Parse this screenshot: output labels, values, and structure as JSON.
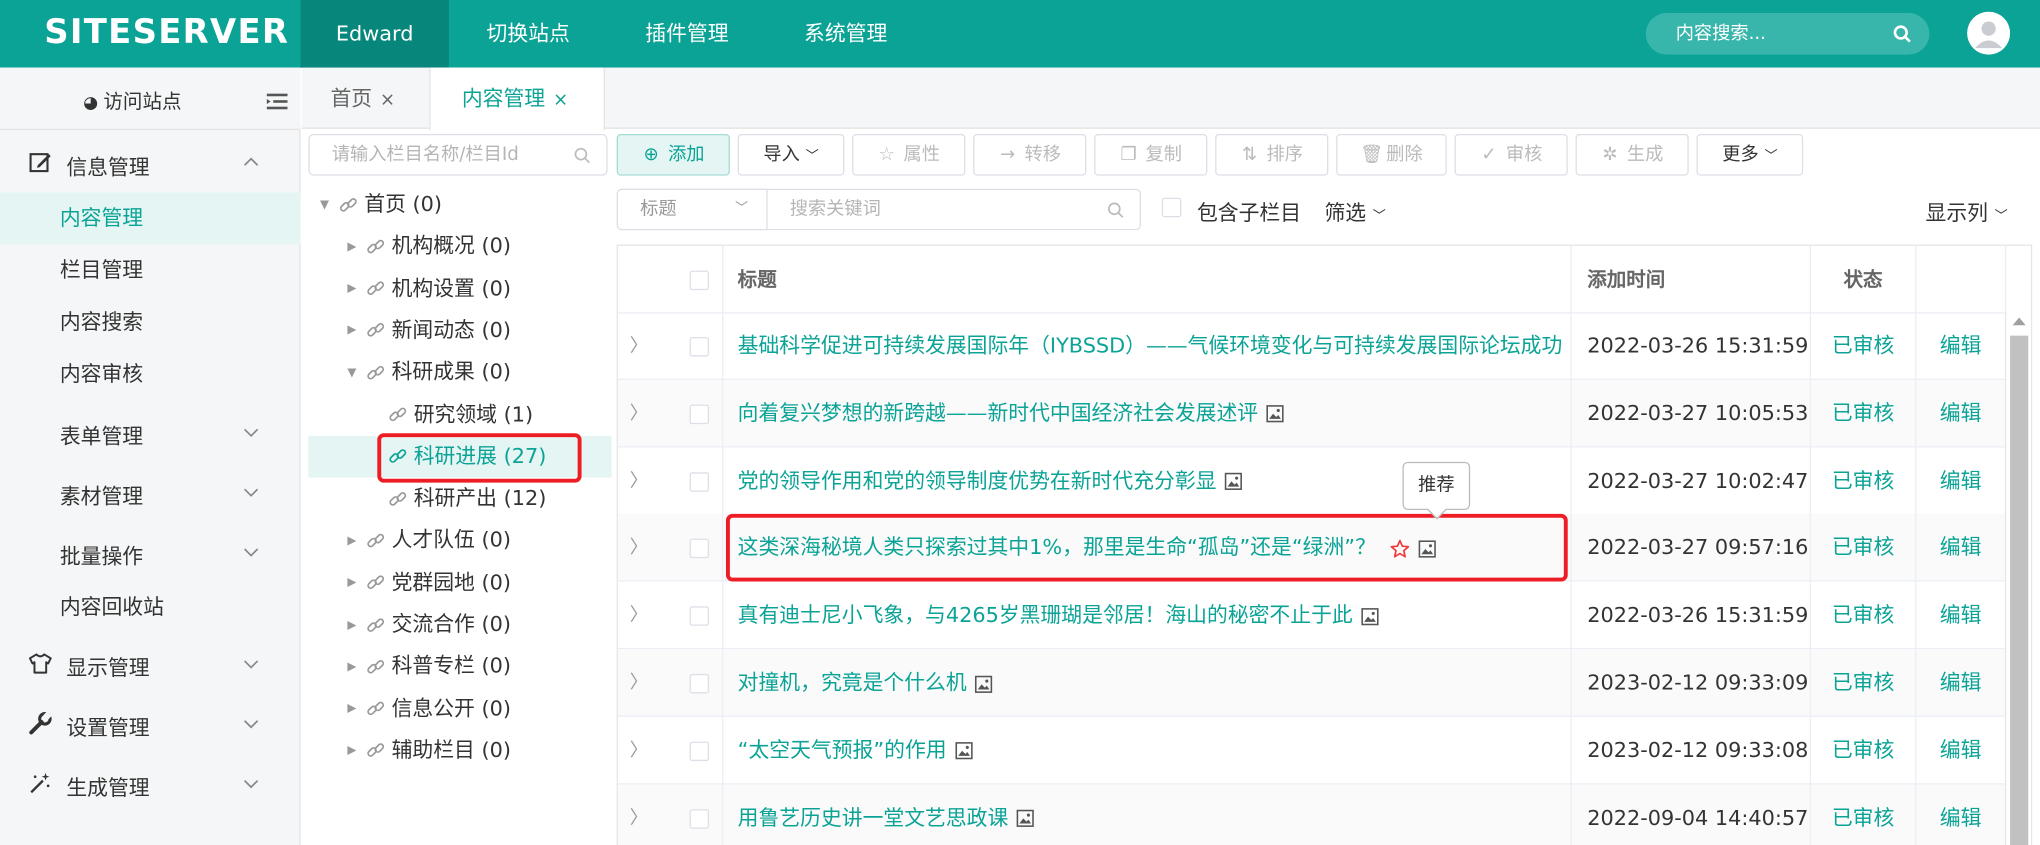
{
  "header": {
    "logo": "SITESERVER",
    "nav": [
      "Edward",
      "切换站点",
      "插件管理",
      "系统管理"
    ],
    "search_placeholder": "内容搜索...",
    "brand_color": "#0ba396"
  },
  "sidebar": {
    "visit_label": "访问站点",
    "groups": [
      {
        "label": "信息管理",
        "icon": "edit-icon",
        "expanded": true,
        "items": [
          "内容管理",
          "栏目管理",
          "内容搜索",
          "内容审核"
        ]
      },
      {
        "label": "表单管理"
      },
      {
        "label": "素材管理"
      },
      {
        "label": "批量操作",
        "items": [
          "内容回收站"
        ]
      },
      {
        "label": "显示管理",
        "icon": "shirt-icon"
      },
      {
        "label": "设置管理",
        "icon": "wrench-icon"
      },
      {
        "label": "生成管理",
        "icon": "magic-wand-icon"
      }
    ],
    "active_item": "内容管理"
  },
  "tabs": [
    {
      "label": "首页",
      "close": "×"
    },
    {
      "label": "内容管理",
      "close": "×",
      "active": true
    }
  ],
  "tree": {
    "search_placeholder": "请输入栏目名称/栏目Id",
    "nodes": [
      {
        "label": "首页 (0)",
        "level": 0,
        "arrow": "▼"
      },
      {
        "label": "机构概况 (0)",
        "level": 1,
        "arrow": "▶"
      },
      {
        "label": "机构设置 (0)",
        "level": 1,
        "arrow": "▶"
      },
      {
        "label": "新闻动态 (0)",
        "level": 1,
        "arrow": "▶"
      },
      {
        "label": "科研成果 (0)",
        "level": 1,
        "arrow": "▼"
      },
      {
        "label": "研究领域 (1)",
        "level": 2
      },
      {
        "label": "科研进展 (27)",
        "level": 2,
        "selected": true
      },
      {
        "label": "科研产出 (12)",
        "level": 2
      },
      {
        "label": "人才队伍 (0)",
        "level": 1,
        "arrow": "▶"
      },
      {
        "label": "党群园地 (0)",
        "level": 1,
        "arrow": "▶"
      },
      {
        "label": "交流合作 (0)",
        "level": 1,
        "arrow": "▶"
      },
      {
        "label": "科普专栏 (0)",
        "level": 1,
        "arrow": "▶"
      },
      {
        "label": "信息公开 (0)",
        "level": 1,
        "arrow": "▶"
      },
      {
        "label": "辅助栏目 (0)",
        "level": 1,
        "arrow": "▶"
      }
    ]
  },
  "toolbar": {
    "add": "添加",
    "import": "导入",
    "attributes": "属性",
    "transfer": "转移",
    "copy": "复制",
    "sort": "排序",
    "delete": "删除",
    "audit": "审核",
    "generate": "生成",
    "more": "更多"
  },
  "filter": {
    "field": "标题",
    "keyword_placeholder": "搜索关键词",
    "include_children": "包含子栏目",
    "filter": "筛选",
    "columns": "显示列"
  },
  "table": {
    "headers": {
      "title": "标题",
      "add_time": "添加时间",
      "status": "状态"
    },
    "rows": [
      {
        "title": "基础科学促进可持续发展国际年（IYBSSD）——气候环境变化与可持续发展国际论坛成功",
        "time": "2022-03-26 15:31:59",
        "status": "已审核",
        "action": "编辑",
        "image": false
      },
      {
        "title": "向着复兴梦想的新跨越——新时代中国经济社会发展述评",
        "time": "2022-03-27 10:05:53",
        "status": "已审核",
        "action": "编辑",
        "image": true
      },
      {
        "title": "党的领导作用和党的领导制度优势在新时代充分彰显",
        "time": "2022-03-27 10:02:47",
        "status": "已审核",
        "action": "编辑",
        "image": true
      },
      {
        "title": "这类深海秘境人类只探索过其中1%，那里是生命“孤岛”还是“绿洲”？",
        "time": "2022-03-27 09:57:16",
        "status": "已审核",
        "action": "编辑",
        "image": true,
        "recommended": true
      },
      {
        "title": "真有迪士尼小飞象，与4265岁黑珊瑚是邻居！海山的秘密不止于此",
        "time": "2022-03-26 15:31:59",
        "status": "已审核",
        "action": "编辑",
        "image": true
      },
      {
        "title": "对撞机，究竟是个什么机",
        "time": "2023-02-12 09:33:09",
        "status": "已审核",
        "action": "编辑",
        "image": true
      },
      {
        "title": "“太空天气预报”的作用",
        "time": "2023-02-12 09:33:08",
        "status": "已审核",
        "action": "编辑",
        "image": true
      },
      {
        "title": "用鲁艺历史讲一堂文艺思政课",
        "time": "2022-09-04 14:40:57",
        "status": "已审核",
        "action": "编辑",
        "image": true
      }
    ],
    "tooltip": "推荐"
  }
}
